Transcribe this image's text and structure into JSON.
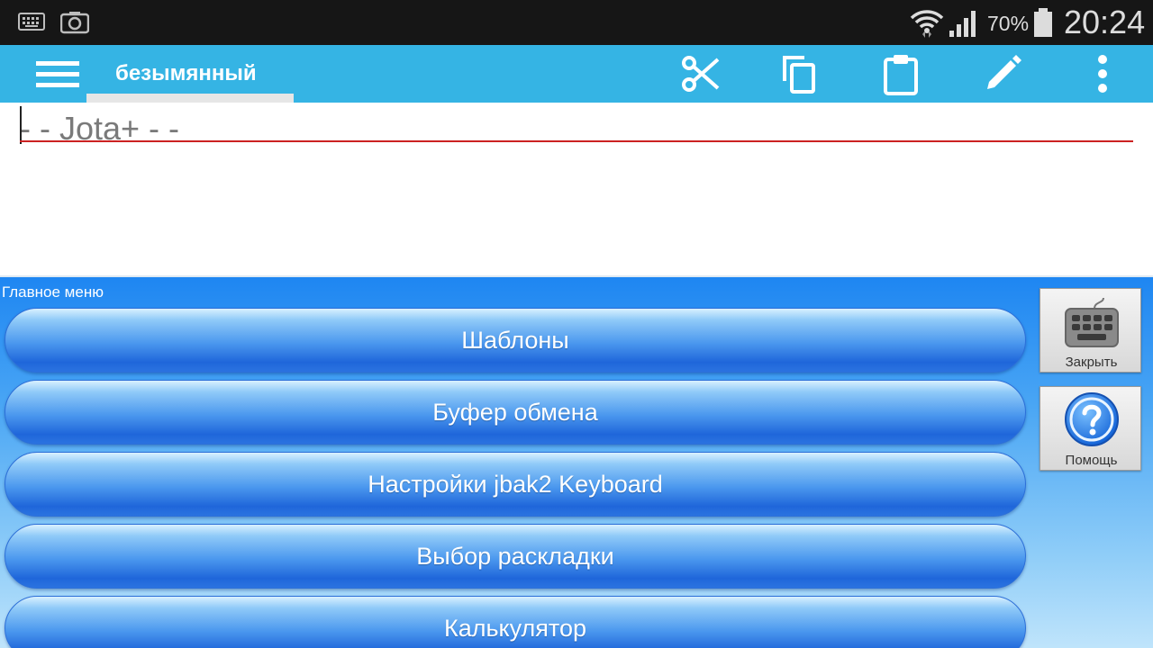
{
  "status_bar": {
    "battery_percent": "70%",
    "clock": "20:24",
    "icons": [
      "keyboard-icon",
      "screenshot-icon",
      "wifi-icon",
      "signal-icon",
      "battery-icon"
    ]
  },
  "action_bar": {
    "doc_title": "безымянный",
    "icons": [
      "menu-icon",
      "cut-icon",
      "copy-icon",
      "paste-icon",
      "edit-icon",
      "overflow-icon"
    ],
    "color": "#35b4e4"
  },
  "editor": {
    "text": "- - Jota+ - -"
  },
  "keyboard_panel": {
    "title": "Главное меню",
    "items": [
      {
        "label": "Шаблоны"
      },
      {
        "label": "Буфер обмена"
      },
      {
        "label": "Настройки jbak2 Keyboard"
      },
      {
        "label": "Выбор раскладки"
      },
      {
        "label": "Калькулятор"
      }
    ],
    "side_buttons": {
      "close_label": "Закрыть",
      "help_label": "Помощь"
    }
  }
}
